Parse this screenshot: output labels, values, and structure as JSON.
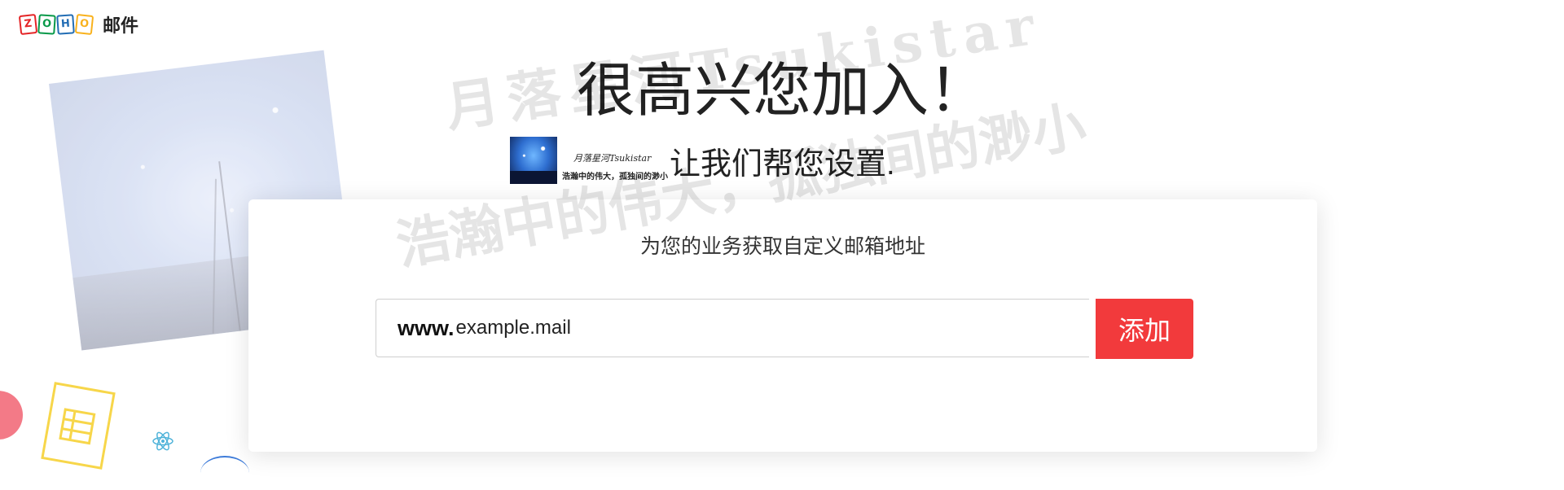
{
  "header": {
    "logo_letters": [
      "Z",
      "O",
      "H",
      "O"
    ],
    "product_name": "邮件"
  },
  "main": {
    "title": "很高兴您加入！",
    "subtitle": "让我们帮您设置."
  },
  "watermark": {
    "line1": "月落星河Tsukistar",
    "line2": "浩瀚中的伟大，孤独间的渺小"
  },
  "card": {
    "heading": "为您的业务获取自定义邮箱地址",
    "domain_prefix": "www.",
    "domain_placeholder": "example.mail",
    "add_button": "添加"
  },
  "colors": {
    "accent": "#f23a3c",
    "logo": [
      "#e42527",
      "#089949",
      "#226db4",
      "#f9b21d"
    ]
  },
  "icons": [
    "grid-icon",
    "atom-icon"
  ]
}
